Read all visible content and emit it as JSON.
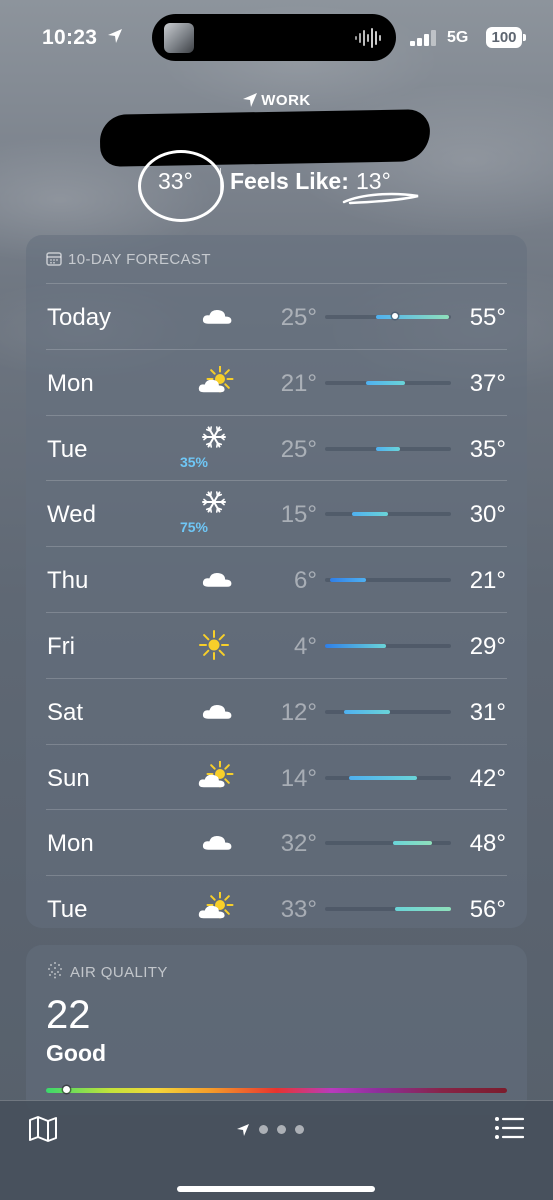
{
  "status_bar": {
    "time": "10:23",
    "network": "5G",
    "battery": "100"
  },
  "header": {
    "location_label": "WORK",
    "current_temp": "33°",
    "feels_like_label": "Feels Like:",
    "feels_like_value": "13°"
  },
  "forecast": {
    "title": "10-DAY FORECAST",
    "range_min": 4,
    "range_max": 56,
    "current_temp_value": 33,
    "days": [
      {
        "day": "Today",
        "icon": "cloud-icon",
        "precip": "",
        "low": "25°",
        "high": "55°",
        "low_value": 25,
        "high_value": 55
      },
      {
        "day": "Mon",
        "icon": "partly-sunny-icon",
        "precip": "",
        "low": "21°",
        "high": "37°",
        "low_value": 21,
        "high_value": 37
      },
      {
        "day": "Tue",
        "icon": "snowflake-icon",
        "precip": "35%",
        "low": "25°",
        "high": "35°",
        "low_value": 25,
        "high_value": 35
      },
      {
        "day": "Wed",
        "icon": "snowflake-icon",
        "precip": "75%",
        "low": "15°",
        "high": "30°",
        "low_value": 15,
        "high_value": 30
      },
      {
        "day": "Thu",
        "icon": "cloud-icon",
        "precip": "",
        "low": "6°",
        "high": "21°",
        "low_value": 6,
        "high_value": 21
      },
      {
        "day": "Fri",
        "icon": "sun-icon",
        "precip": "",
        "low": "4°",
        "high": "29°",
        "low_value": 4,
        "high_value": 29
      },
      {
        "day": "Sat",
        "icon": "cloud-icon",
        "precip": "",
        "low": "12°",
        "high": "31°",
        "low_value": 12,
        "high_value": 31
      },
      {
        "day": "Sun",
        "icon": "partly-sunny-icon",
        "precip": "",
        "low": "14°",
        "high": "42°",
        "low_value": 14,
        "high_value": 42
      },
      {
        "day": "Mon",
        "icon": "cloud-icon",
        "precip": "",
        "low": "32°",
        "high": "48°",
        "low_value": 32,
        "high_value": 48
      },
      {
        "day": "Tue",
        "icon": "partly-sunny-icon",
        "precip": "",
        "low": "33°",
        "high": "56°",
        "low_value": 33,
        "high_value": 56
      }
    ]
  },
  "air_quality": {
    "title": "AIR QUALITY",
    "value": "22",
    "label": "Good",
    "index_fraction": 0.045
  },
  "colors": {
    "cold": "#2f7fe8",
    "cool": "#4fb0f0",
    "mild": "#6ad4d8",
    "warm": "#8fe0bb"
  }
}
